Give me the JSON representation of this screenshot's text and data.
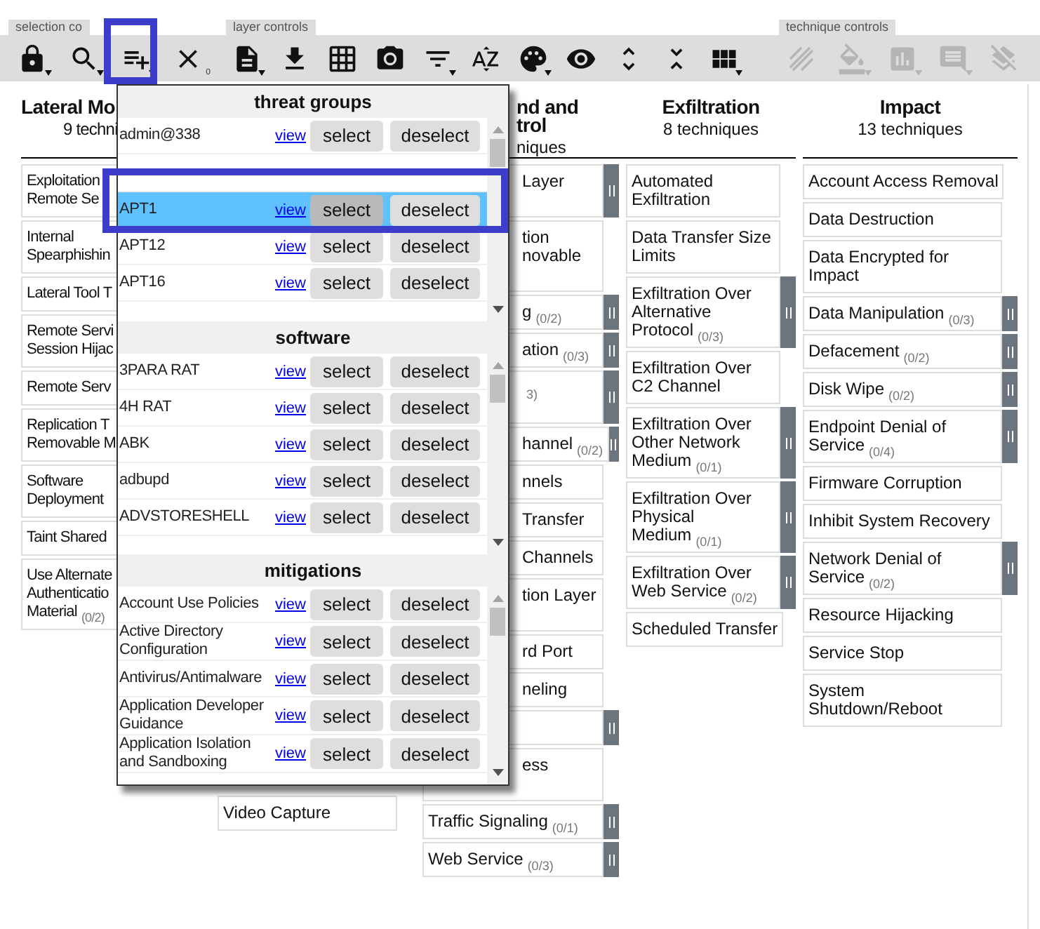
{
  "toolbar": {
    "groups": [
      {
        "label": "selection co",
        "disabled": false,
        "buttons": [
          {
            "dropdown": true,
            "annotated": false
          },
          {
            "dropdown": true,
            "annotated": false
          },
          {
            "dropdown": true,
            "annotated": true
          },
          {
            "dropdown": false,
            "annotated": false,
            "badge": "0"
          }
        ]
      },
      {
        "label": "layer controls",
        "disabled": false,
        "buttons": [
          {
            "dropdown": true,
            "annotated": false
          },
          {
            "dropdown": false,
            "annotated": false
          },
          {
            "dropdown": false,
            "annotated": false
          },
          {
            "dropdown": false,
            "annotated": false
          },
          {
            "dropdown": true,
            "annotated": false
          },
          {
            "dropdown": false,
            "annotated": false
          },
          {
            "dropdown": true,
            "annotated": false
          },
          {
            "dropdown": false,
            "annotated": false
          },
          {
            "dropdown": false,
            "annotated": false
          },
          {
            "dropdown": false,
            "annotated": false
          },
          {
            "dropdown": true,
            "annotated": false
          }
        ]
      },
      {
        "label": "technique controls",
        "disabled": true,
        "buttons": [
          {
            "dropdown": false,
            "annotated": false
          },
          {
            "dropdown": true,
            "annotated": false
          },
          {
            "dropdown": true,
            "annotated": false
          },
          {
            "dropdown": true,
            "annotated": false
          },
          {
            "dropdown": false,
            "annotated": false
          }
        ]
      }
    ]
  },
  "matrix": {
    "columns": [
      {
        "kind": "clipped-right",
        "title": [
          "Lateral Mo"
        ],
        "subtitle": "9 techni",
        "techniques": [
          {
            "lines": [
              "Exploitation",
              "Remote Se"
            ],
            "toggle": false
          },
          {
            "lines": [
              "Internal",
              "Spearphishin"
            ],
            "toggle": false
          },
          {
            "lines": [
              "Lateral Tool T"
            ],
            "toggle": false
          },
          {
            "lines": [
              "Remote Servi",
              "Session Hijac"
            ],
            "toggle": false
          },
          {
            "lines": [
              "Remote Serv"
            ],
            "toggle": false
          },
          {
            "lines": [
              "Replication T",
              "Removable M"
            ],
            "toggle": false
          },
          {
            "lines": [
              "Software",
              "Deployment"
            ],
            "toggle": false
          },
          {
            "lines": [
              "Taint Shared"
            ],
            "toggle": false
          },
          {
            "lines": [
              "Use Alternate",
              "Authenticatio",
              "Material"
            ],
            "count": "(0/2)",
            "toggle": false
          }
        ]
      },
      {
        "kind": "bottom-only",
        "techniques": [
          {
            "lines": [
              "Video Capture"
            ],
            "toggle": false
          }
        ]
      },
      {
        "kind": "clipped-left",
        "title": [
          "nd and",
          "trol"
        ],
        "subtitle": "niques",
        "techniques": [
          {
            "lines": [
              "Layer"
            ],
            "extra_line": true,
            "toggle": true
          },
          {
            "lines": [
              "tion",
              "novable"
            ],
            "extra_line": true,
            "toggle": false
          },
          {
            "lines": [
              "g"
            ],
            "count": "(0/2)",
            "toggle": true
          },
          {
            "lines": [
              "ation"
            ],
            "count": "(0/3)",
            "toggle": true
          },
          {
            "count": "3)",
            "extra_line": true,
            "toggle": true
          },
          {
            "lines": [
              "hannel"
            ],
            "count": "(0/2)",
            "toggle": true
          },
          {
            "lines": [
              "nnels"
            ],
            "toggle": false
          },
          {
            "lines": [
              "Transfer"
            ],
            "toggle": false
          },
          {
            "lines": [
              "Channels"
            ],
            "toggle": false
          },
          {
            "lines": [
              "tion Layer"
            ],
            "extra_line": true,
            "toggle": false
          },
          {
            "lines": [
              "rd Port"
            ],
            "toggle": false
          },
          {
            "lines": [
              "neling"
            ],
            "toggle": false
          },
          {
            "toggle": true
          },
          {
            "lines": [
              "ess"
            ],
            "extra_line": true,
            "toggle": false
          },
          {
            "lines": [
              "Traffic Signaling"
            ],
            "count": "(0/1)",
            "toggle": true,
            "full": true
          },
          {
            "lines": [
              "Web Service"
            ],
            "count": "(0/3)",
            "toggle": true,
            "full": true
          }
        ]
      },
      {
        "kind": "full",
        "title": [
          "Exfiltration"
        ],
        "subtitle": "8 techniques",
        "techniques": [
          {
            "lines": [
              "Automated",
              "Exfiltration"
            ],
            "toggle": false
          },
          {
            "lines": [
              "Data Transfer Size",
              "Limits"
            ],
            "toggle": false
          },
          {
            "lines": [
              "Exfiltration Over",
              "Alternative",
              "Protocol"
            ],
            "count": "(0/3)",
            "toggle": true
          },
          {
            "lines": [
              "Exfiltration Over",
              "C2 Channel"
            ],
            "toggle": false
          },
          {
            "lines": [
              "Exfiltration Over",
              "Other Network",
              "Medium"
            ],
            "count": "(0/1)",
            "toggle": true
          },
          {
            "lines": [
              "Exfiltration Over",
              "Physical",
              "Medium"
            ],
            "count": "(0/1)",
            "toggle": true
          },
          {
            "lines": [
              "Exfiltration Over",
              "Web Service"
            ],
            "count": "(0/2)",
            "toggle": true
          },
          {
            "lines": [
              "Scheduled Transfer"
            ],
            "toggle": false
          }
        ]
      },
      {
        "kind": "full",
        "title": [
          "Impact"
        ],
        "subtitle": "13 techniques",
        "techniques": [
          {
            "lines": [
              "Account Access Removal"
            ],
            "toggle": false
          },
          {
            "lines": [
              "Data Destruction"
            ],
            "toggle": false
          },
          {
            "lines": [
              "Data Encrypted for",
              "Impact"
            ],
            "toggle": false
          },
          {
            "lines": [
              "Data Manipulation"
            ],
            "count": "(0/3)",
            "toggle": true
          },
          {
            "lines": [
              "Defacement"
            ],
            "count": "(0/2)",
            "toggle": true
          },
          {
            "lines": [
              "Disk Wipe"
            ],
            "count": "(0/2)",
            "toggle": true
          },
          {
            "lines": [
              "Endpoint Denial of",
              "Service"
            ],
            "count": "(0/4)",
            "toggle": true
          },
          {
            "lines": [
              "Firmware Corruption"
            ],
            "toggle": false
          },
          {
            "lines": [
              "Inhibit System Recovery"
            ],
            "toggle": false
          },
          {
            "lines": [
              "Network Denial of",
              "Service"
            ],
            "count": "(0/2)",
            "toggle": true
          },
          {
            "lines": [
              "Resource Hijacking"
            ],
            "toggle": false
          },
          {
            "lines": [
              "Service Stop"
            ],
            "toggle": false
          },
          {
            "lines": [
              "System",
              "Shutdown/Reboot"
            ],
            "toggle": false
          }
        ]
      }
    ]
  },
  "dropdown": {
    "sections": [
      {
        "title": "threat groups",
        "rows": [
          {
            "name": "admin@338",
            "link": "view",
            "select": "select",
            "deselect": "deselect",
            "selected": false,
            "annotated": false
          },
          {
            "selected": false,
            "annotated": false
          },
          {
            "name": "APT1",
            "link": "view",
            "select": "select",
            "deselect": "deselect",
            "selected": true,
            "annotated": true
          },
          {
            "name": "APT12",
            "link": "view",
            "select": "select",
            "deselect": "deselect",
            "selected": false,
            "annotated": false
          },
          {
            "name": "APT16",
            "link": "view",
            "select": "select",
            "deselect": "deselect",
            "selected": false,
            "annotated": false
          }
        ]
      },
      {
        "title": "software",
        "rows": [
          {
            "name": "3PARA RAT",
            "link": "view",
            "select": "select",
            "deselect": "deselect",
            "selected": false,
            "annotated": false
          },
          {
            "name": "4H RAT",
            "link": "view",
            "select": "select",
            "deselect": "deselect",
            "selected": false,
            "annotated": false
          },
          {
            "name": "ABK",
            "link": "view",
            "select": "select",
            "deselect": "deselect",
            "selected": false,
            "annotated": false
          },
          {
            "name": "adbupd",
            "link": "view",
            "select": "select",
            "deselect": "deselect",
            "selected": false,
            "annotated": false
          },
          {
            "name": "ADVSTORESHELL",
            "link": "view",
            "select": "select",
            "deselect": "deselect",
            "selected": false,
            "annotated": false
          }
        ]
      },
      {
        "title": "mitigations",
        "rows": [
          {
            "name": "Account Use Policies",
            "link": "view",
            "select": "select",
            "deselect": "deselect",
            "selected": false,
            "annotated": false
          },
          {
            "name": "Active Directory Configuration",
            "link": "view",
            "select": "select",
            "deselect": "deselect",
            "selected": false,
            "annotated": false
          },
          {
            "name": "Antivirus/Antimalware",
            "link": "view",
            "select": "select",
            "deselect": "deselect",
            "selected": false,
            "annotated": false
          },
          {
            "name": "Application Developer Guidance",
            "link": "view",
            "select": "select",
            "deselect": "deselect",
            "selected": false,
            "annotated": false
          },
          {
            "name": "Application Isolation and Sandboxing",
            "link": "view",
            "select": "select",
            "deselect": "deselect",
            "selected": false,
            "annotated": false
          }
        ]
      }
    ]
  }
}
